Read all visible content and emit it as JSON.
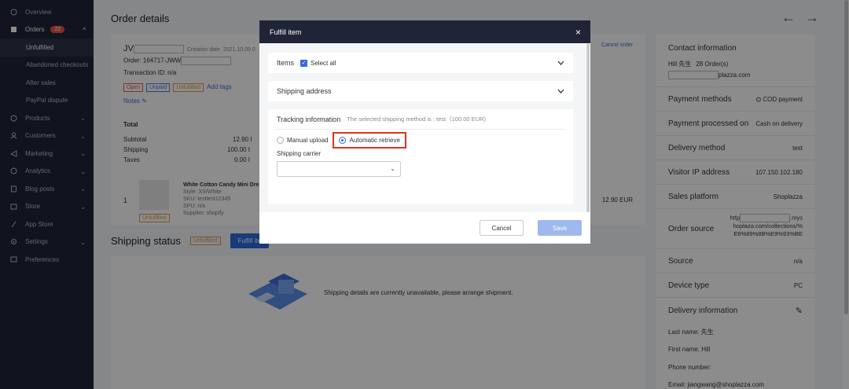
{
  "sidebar": {
    "items": [
      {
        "label": "Overview",
        "icon": "overview-icon"
      },
      {
        "label": "Orders",
        "icon": "orders-icon",
        "badge": "22"
      },
      {
        "label": "Unfulfilled"
      },
      {
        "label": "Abandoned checkouts"
      },
      {
        "label": "After sales"
      },
      {
        "label": "PayPal dispute"
      },
      {
        "label": "Products",
        "icon": "products-icon"
      },
      {
        "label": "Customers",
        "icon": "customers-icon"
      },
      {
        "label": "Marketing",
        "icon": "marketing-icon"
      },
      {
        "label": "Analytics",
        "icon": "analytics-icon"
      },
      {
        "label": "Blog posts",
        "icon": "blog-icon"
      },
      {
        "label": "Store",
        "icon": "store-icon"
      },
      {
        "label": "App Store",
        "icon": "app-store-icon"
      },
      {
        "label": "Settings",
        "icon": "settings-icon"
      },
      {
        "label": "Preferences",
        "icon": "preferences-icon"
      }
    ]
  },
  "page": {
    "title": "Order details",
    "nav_prev": "←",
    "nav_next": "→"
  },
  "order": {
    "id_prefix": "JV",
    "creation_label": "Creation date",
    "creation_date": "2021.10.09 0",
    "order_label": "Order: 164717-JWW",
    "transaction": "Transaction ID: n/a",
    "tags": [
      "Open",
      "Unpaid",
      "Unfulfilled"
    ],
    "add_tags": "Add tags",
    "notes": "Notes",
    "cancel_order": "Cancel order",
    "total_label": "Total",
    "subtotal_label": "Subtotal",
    "subtotal_value": "12.90 I",
    "shipping_label": "Shipping",
    "shipping_value": "100.00 I",
    "taxes_label": "Taxes",
    "taxes_value": "0.00 I",
    "item_qty": "1",
    "item_name": "White Cotton Candy Mini Dre",
    "item_style": "Style: XS/White",
    "item_sku": "SKU: testtest12345",
    "item_spu": "SPU: n/a",
    "item_supplier": "Supplier: shopify",
    "item_status": "Unfulfilled",
    "item_price": "12.90 EUR"
  },
  "shipping_status": {
    "title": "Shipping status",
    "tag": "Unfulfilled",
    "fulfill_button": "Fulfill ite",
    "message": "Shipping details are currently unavailable, please arrange shipment."
  },
  "contact": {
    "title": "Contact information",
    "customer": "Hill 先生",
    "orders": "28 Order(s)",
    "email_suffix": "plazza.com",
    "rows": [
      {
        "label": "Payment methods",
        "value": "COD payment"
      },
      {
        "label": "Payment processed on",
        "value": "Cash on delivery"
      },
      {
        "label": "Delivery method",
        "value": "test"
      },
      {
        "label": "Visitor IP address",
        "value": "107.150.102.180"
      },
      {
        "label": "Sales platform",
        "value": "Shoplazza"
      },
      {
        "label": "Order source",
        "value_line1": "http",
        "value_line1b": ".mys",
        "value_line2": "hoplaza.com/collections/%",
        "value_line3": "E6%89%8B%E9%93%BE"
      },
      {
        "label": "Source",
        "value": "n/a"
      },
      {
        "label": "Device type",
        "value": "PC"
      }
    ],
    "delivery_title": "Delivery information",
    "last_name": "Last name: 先生",
    "first_name": "First name: Hill",
    "phone": "Phone number:",
    "email": "Email: jiangwang@shoplazza.com"
  },
  "modal": {
    "title": "Fulfill item",
    "close": "×",
    "items_label": "Items",
    "select_all": "Select all",
    "shipping_address": "Shipping address",
    "tracking_title": "Tracking information",
    "tracking_note": "The selected shipping method is : test（100.00 EUR)",
    "manual_upload": "Manual upload",
    "automatic_retrieve": "Automatic retrieve",
    "carrier_label": "Shipping carrier",
    "cancel": "Cancel",
    "save": "Save"
  },
  "colors": {
    "sidebar_bg": "#1f2537",
    "primary": "#2d6cdf",
    "highlight": "#e0321c"
  }
}
